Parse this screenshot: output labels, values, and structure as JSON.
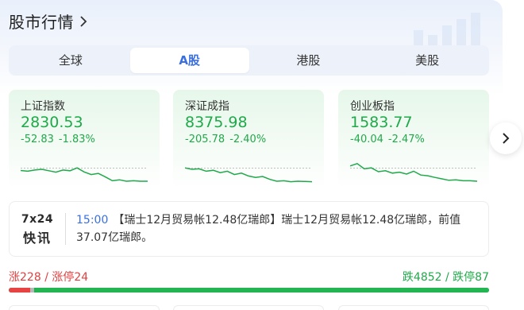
{
  "header": {
    "title": "股市行情"
  },
  "tabs": [
    {
      "label": "全球",
      "active": false
    },
    {
      "label": "A股",
      "active": true
    },
    {
      "label": "港股",
      "active": false
    },
    {
      "label": "美股",
      "active": false
    }
  ],
  "indices": [
    {
      "name": "上证指数",
      "value": "2830.53",
      "change": "-52.83",
      "pct": "-1.83%",
      "sparkline": [
        0.55,
        0.52,
        0.57,
        0.6,
        0.54,
        0.48,
        0.57,
        0.54,
        0.66,
        0.49,
        0.38,
        0.43,
        0.28,
        0.12,
        0.16,
        0.1,
        0.12,
        0.1,
        0.1
      ]
    },
    {
      "name": "深证成指",
      "value": "8375.98",
      "change": "-205.78",
      "pct": "-2.40%",
      "sparkline": [
        0.66,
        0.6,
        0.62,
        0.52,
        0.56,
        0.46,
        0.52,
        0.38,
        0.44,
        0.32,
        0.26,
        0.3,
        0.18,
        0.1,
        0.12,
        0.08,
        0.1,
        0.09,
        0.08
      ]
    },
    {
      "name": "创业板指",
      "value": "1583.77",
      "change": "-40.04",
      "pct": "-2.47%",
      "sparkline": [
        0.74,
        0.84,
        0.62,
        0.66,
        0.5,
        0.54,
        0.44,
        0.48,
        0.4,
        0.52,
        0.36,
        0.33,
        0.26,
        0.2,
        0.14,
        0.16,
        0.12,
        0.12,
        0.1
      ]
    }
  ],
  "sparkline_color": "#20a94a",
  "news": {
    "badge_top": "7x24",
    "badge_bottom": "快讯",
    "time": "15:00",
    "text": "【瑞士12月贸易帐12.48亿瑞郎】瑞士12月贸易帐12.48亿瑞郎，前值37.07亿瑞郎。"
  },
  "breadth": {
    "up_label": "涨228",
    "limit_up_label": "涨停24",
    "down_label": "跌4852",
    "limit_down_label": "跌停87",
    "up_count": 228,
    "down_count": 4852,
    "flat_count": 40
  },
  "colors": {
    "up": "#e04040",
    "down": "#20a94a",
    "accent": "#3a6fe0"
  }
}
